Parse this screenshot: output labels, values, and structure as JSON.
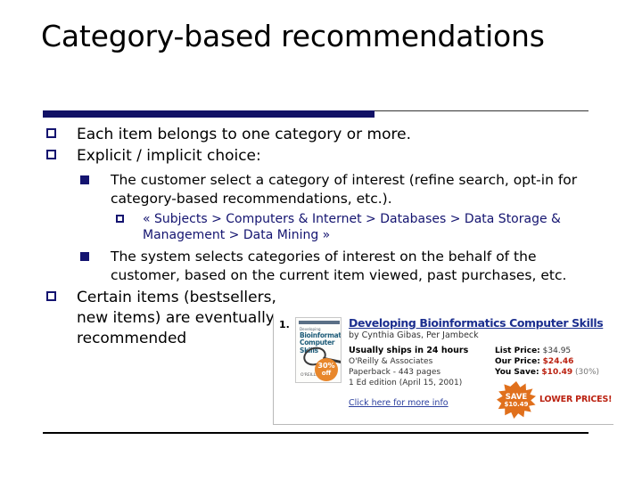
{
  "slide": {
    "title": "Category-based recommendations",
    "accent_navy": "#141470",
    "bullets": [
      {
        "level": 1,
        "marker": "hollow-square",
        "text": "Each item belongs to one category or more."
      },
      {
        "level": 1,
        "marker": "hollow-square",
        "text": "Explicit / implicit choice:"
      },
      {
        "level": 2,
        "marker": "filled-square",
        "text": "The customer select a category of interest (refine search, opt-in for category-based recommendations, etc.)."
      },
      {
        "level": 3,
        "marker": "hollow-square",
        "text": "« Subjects > Computers & Internet > Databases > Data Storage & Management > Data Mining »"
      },
      {
        "level": 2,
        "marker": "filled-square",
        "text": "The system selects categories of interest on the behalf of the customer, based on the current item viewed, past purchases, etc."
      },
      {
        "level": 1,
        "marker": "hollow-square",
        "text": "Certain items (bestsellers, new items) are eventually recommended"
      }
    ]
  },
  "screenshot": {
    "result_number": "1.",
    "cover": {
      "pretitle": "Developing",
      "title_line1": "Bioinformatics",
      "title_line2": "Computer Skills",
      "author_small": "O'REILLY",
      "badge_percent": "30%",
      "badge_suffix": "off"
    },
    "book_title": "Developing Bioinformatics Computer Skills",
    "byline": "by Cynthia Gibas, Per Jambeck",
    "availability": "Usually ships in 24 hours",
    "publisher": "O'Reilly & Associates",
    "format": "Paperback - 443 pages",
    "edition": "1 Ed edition (April 15, 2001)",
    "more_info_link": "Click here for more info",
    "list_price_label": "List Price:",
    "list_price_value": "$34.95",
    "our_price_label": "Our Price:",
    "our_price_value": "$24.46",
    "you_save_label": "You Save:",
    "you_save_value": "$10.49",
    "you_save_percent": "(30%)",
    "save_badge_line1": "SAVE",
    "save_badge_line2": "$10.49",
    "lower_prices": "LOWER PRICES!",
    "colors": {
      "link": "#1c2f8f",
      "price_red": "#bb2211",
      "badge_orange": "#e0701c"
    }
  }
}
